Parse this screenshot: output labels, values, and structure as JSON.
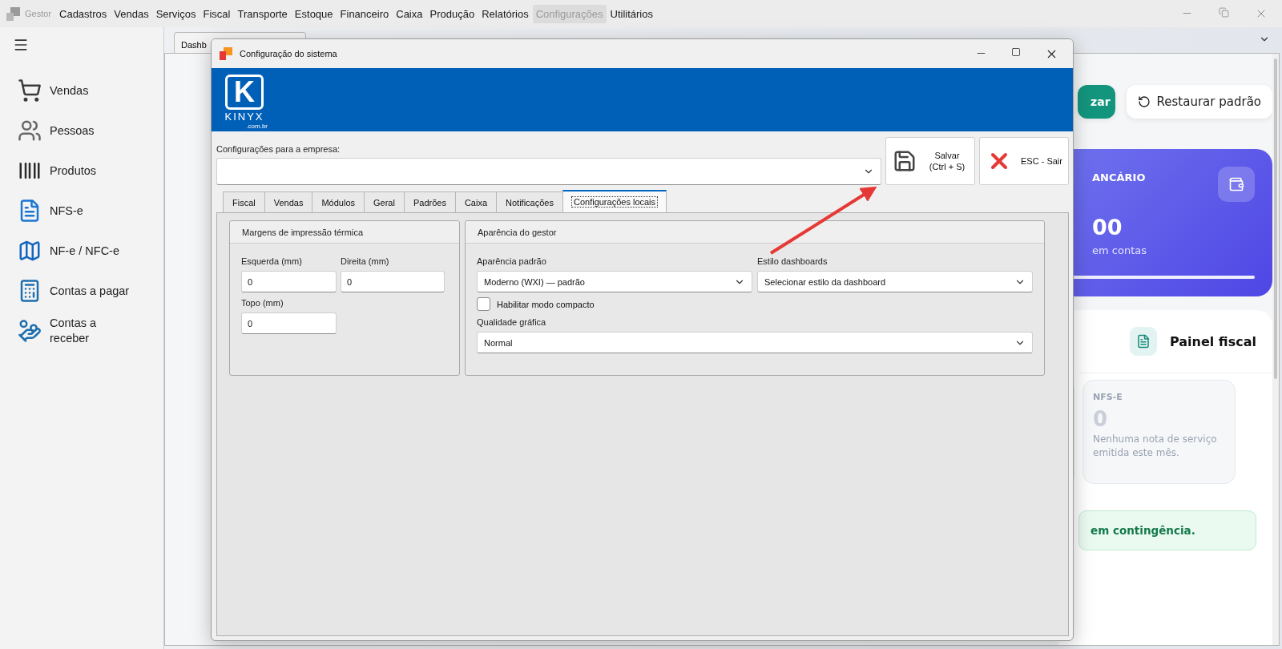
{
  "app": {
    "name": "Gestor"
  },
  "menu": [
    {
      "label": "Cadastros",
      "selected": false
    },
    {
      "label": "Vendas",
      "selected": false
    },
    {
      "label": "Serviços",
      "selected": false
    },
    {
      "label": "Fiscal",
      "selected": false
    },
    {
      "label": "Transporte",
      "selected": false
    },
    {
      "label": "Estoque",
      "selected": false
    },
    {
      "label": "Financeiro",
      "selected": false
    },
    {
      "label": "Caixa",
      "selected": false
    },
    {
      "label": "Produção",
      "selected": false
    },
    {
      "label": "Relatórios",
      "selected": false
    },
    {
      "label": "Configurações",
      "selected": true
    },
    {
      "label": "Utilitários",
      "selected": false
    }
  ],
  "sidebar": {
    "items": [
      {
        "label": "Vendas",
        "kind": "cart"
      },
      {
        "label": "Pessoas",
        "kind": "people"
      },
      {
        "label": "Produtos",
        "kind": "barcode"
      },
      {
        "label": "NFS-e",
        "kind": "document"
      },
      {
        "label": "NF-e / NFC-e",
        "kind": "map"
      },
      {
        "label": "Contas a pagar",
        "kind": "calculator"
      },
      {
        "label": "Contas a\nreceber",
        "kind": "coins"
      }
    ]
  },
  "document_tab": {
    "label": "Dashb"
  },
  "dashboard": {
    "buttons": [
      {
        "label": "zar",
        "kind": "primary"
      },
      {
        "label": "Restaurar padrão",
        "kind": "secondary"
      }
    ],
    "balance_card": {
      "title": "ANCÁRIO",
      "value": "00",
      "caption": "em contas",
      "level": 1
    },
    "fiscal_panel": {
      "title": "Painel fiscal",
      "stat": {
        "label": "NFS-E",
        "value": "0",
        "note": "Nenhuma nota de serviço emitida este mês."
      },
      "alert": "em contingência."
    }
  },
  "dialog": {
    "title": "Configuração do sistema",
    "logo": {
      "mark": "K",
      "name": "KINYX",
      "domain": ".com.br"
    },
    "company_label": "Configurações para a empresa:",
    "buttons": [
      {
        "kind": "save",
        "lines": [
          "Salvar",
          "(Ctrl + S)"
        ]
      },
      {
        "kind": "exit",
        "lines": [
          "ESC - Sair"
        ]
      }
    ],
    "tabs": [
      {
        "label": "Fiscal",
        "selected": false
      },
      {
        "label": "Vendas",
        "selected": false
      },
      {
        "label": "Módulos",
        "selected": false
      },
      {
        "label": "Geral",
        "selected": false
      },
      {
        "label": "Padrões",
        "selected": false
      },
      {
        "label": "Caixa",
        "selected": false
      },
      {
        "label": "Notificações",
        "selected": false
      },
      {
        "label": "Configurações locais",
        "selected": true
      }
    ],
    "margins": {
      "title": "Margens de impressão térmica",
      "fields": [
        {
          "label": "Esquerda (mm)",
          "value": "0"
        },
        {
          "label": "Direita (mm)",
          "value": "0"
        },
        {
          "label": "Topo (mm)",
          "value": "0"
        }
      ]
    },
    "appearance": {
      "title": "Aparência do gestor",
      "default_look": {
        "label": "Aparência padrão",
        "value": "Moderno (WXI) — padrão"
      },
      "dashboard_style": {
        "label": "Estilo dashboards",
        "value": "Selecionar estilo da dashboard"
      },
      "compact": {
        "label": "Habilitar modo compacto",
        "checked": false
      },
      "quality": {
        "label": "Qualidade gráfica",
        "value": "Normal"
      }
    }
  }
}
